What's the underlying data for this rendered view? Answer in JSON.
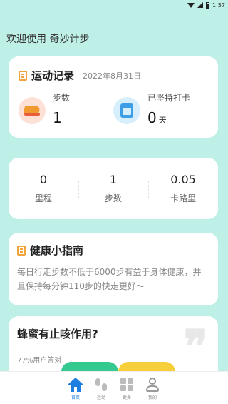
{
  "status_bar": {
    "time": "1:57"
  },
  "welcome": "欢迎使用 奇妙计步",
  "record": {
    "title": "运动记录",
    "date": "2022年8月31日",
    "steps_label": "步数",
    "steps_value": "1",
    "streak_label": "已坚持打卡",
    "streak_value": "0",
    "streak_unit": "天"
  },
  "summary": [
    {
      "value": "0",
      "label": "里程"
    },
    {
      "value": "1",
      "label": "步数"
    },
    {
      "value": "0.05",
      "label": "卡路里"
    }
  ],
  "guide": {
    "title": "健康小指南",
    "text": "每日行走步数不低于6000步有益于身体健康，并且保持每分钟110步的快走更好～"
  },
  "quiz": {
    "question": "蜂蜜有止咳作用?",
    "stat": "77%用户答对"
  },
  "nav": [
    {
      "label": "首页",
      "icon": "home-icon",
      "active": true
    },
    {
      "label": "运动",
      "icon": "footprints-icon",
      "active": false
    },
    {
      "label": "更多",
      "icon": "grid-icon",
      "active": false
    },
    {
      "label": "我的",
      "icon": "user-icon",
      "active": false
    }
  ],
  "colors": {
    "accent": "#1e7fe0",
    "background": "#bff0e8",
    "title_icon": "#f2a33c"
  }
}
